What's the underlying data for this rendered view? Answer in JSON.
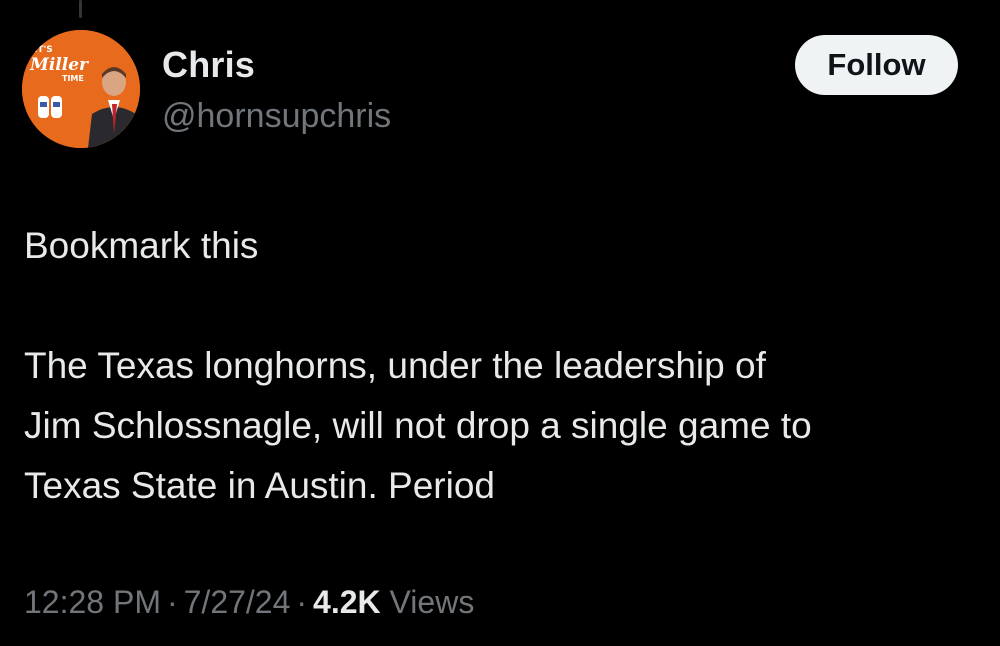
{
  "tweet": {
    "author": {
      "display_name": "Chris",
      "handle": "@hornsupchris",
      "avatar_logo_text": [
        "IT'S",
        "Miller",
        "TIME"
      ]
    },
    "follow_label": "Follow",
    "lines": [
      "Bookmark this",
      "The Texas longhorns, under the leadership of",
      "Jim Schlossnagle, will not drop a single game to",
      "Texas State in Austin. Period"
    ],
    "time": "12:28 PM",
    "date": "7/27/24",
    "separator": "·",
    "views_count": "4.2K",
    "views_label": "Views"
  },
  "colors": {
    "background": "#000000",
    "primary_text": "#e7e9ea",
    "secondary_text": "#71767b",
    "follow_bg": "#eff3f4",
    "avatar_bg": "#e86a1c"
  }
}
